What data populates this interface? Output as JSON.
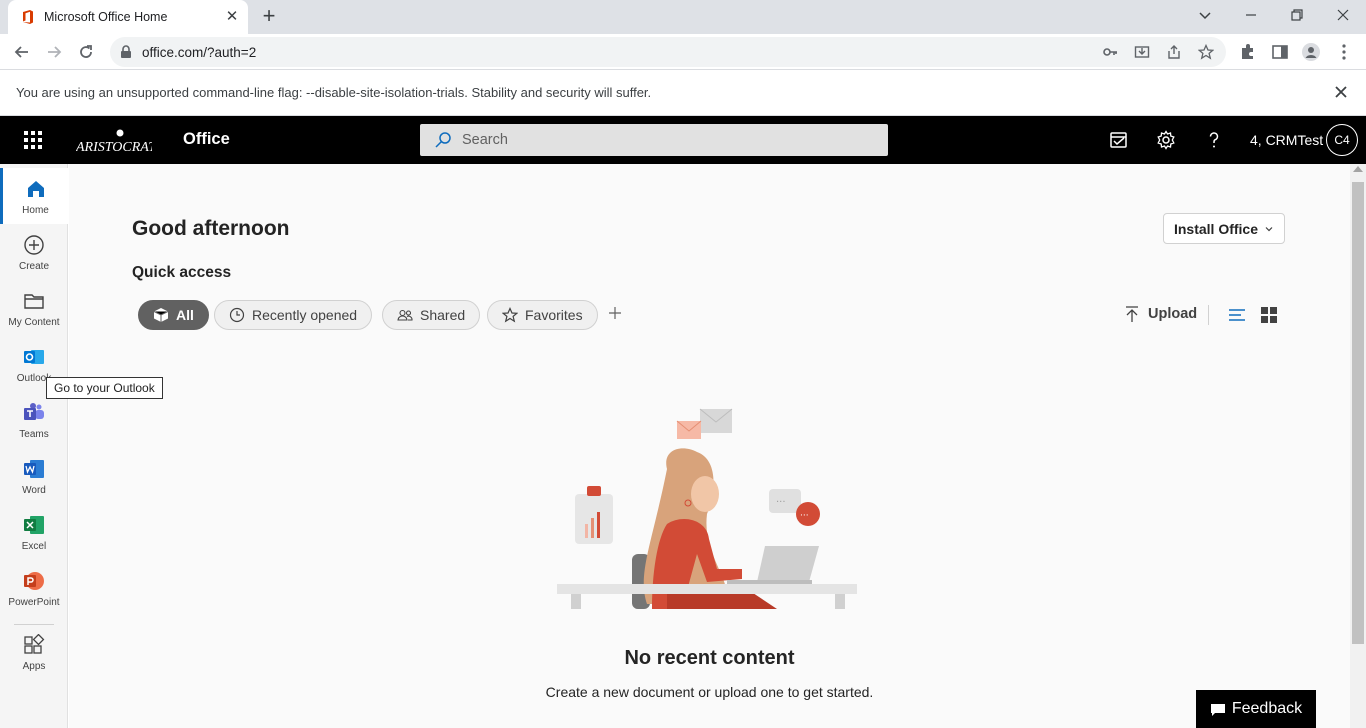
{
  "browser": {
    "tab_title": "Microsoft Office Home",
    "url": "office.com/?auth=2",
    "infobar_text": "You are using an unsupported command-line flag: --disable-site-isolation-trials. Stability and security will suffer."
  },
  "header": {
    "app_name": "Office",
    "search_placeholder": "Search",
    "user_name": "4, CRMTest",
    "avatar_initials": "C4"
  },
  "rail": {
    "items": [
      {
        "label": "Home",
        "icon": "home-icon"
      },
      {
        "label": "Create",
        "icon": "plus-circle-icon"
      },
      {
        "label": "My Content",
        "icon": "folder-icon"
      },
      {
        "label": "Outlook",
        "icon": "outlook-icon"
      },
      {
        "label": "Teams",
        "icon": "teams-icon"
      },
      {
        "label": "Word",
        "icon": "word-icon"
      },
      {
        "label": "Excel",
        "icon": "excel-icon"
      },
      {
        "label": "PowerPoint",
        "icon": "powerpoint-icon"
      },
      {
        "label": "Apps",
        "icon": "apps-icon"
      }
    ],
    "tooltip": "Go to your Outlook"
  },
  "main": {
    "greeting": "Good afternoon",
    "install_label": "Install Office",
    "quick_access_title": "Quick access",
    "filters": [
      {
        "label": "All",
        "selected": true
      },
      {
        "label": "Recently opened",
        "selected": false
      },
      {
        "label": "Shared",
        "selected": false
      },
      {
        "label": "Favorites",
        "selected": false
      }
    ],
    "upload_label": "Upload",
    "empty_title": "No recent content",
    "empty_subtitle": "Create a new document or upload one to get started."
  },
  "feedback_label": "Feedback",
  "colors": {
    "accent": "#0f6cbd",
    "header_bg": "#000000",
    "word": "#185abd",
    "excel": "#107c41",
    "powerpoint": "#c43e1c",
    "teams": "#5b5fc7"
  }
}
